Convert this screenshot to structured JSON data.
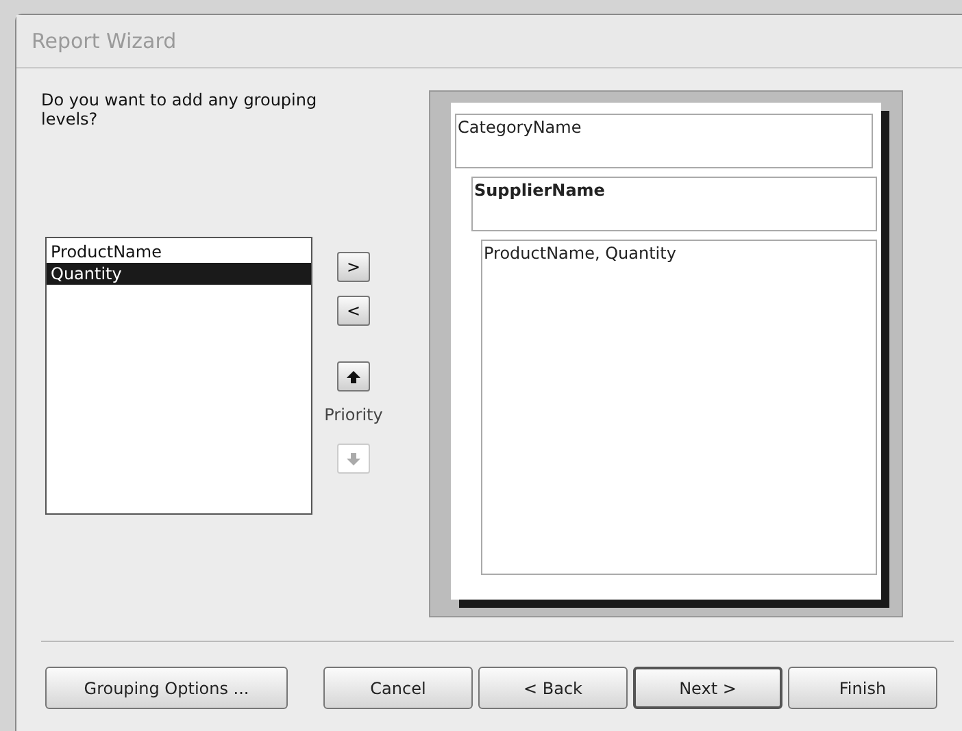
{
  "window": {
    "title": "Report Wizard"
  },
  "question": "Do you want to add any grouping levels?",
  "fields": [
    {
      "label": "ProductName",
      "selected": false
    },
    {
      "label": "Quantity",
      "selected": true
    }
  ],
  "move_buttons": [
    {
      "kind": "text",
      "label": ">",
      "disabled": false
    },
    {
      "kind": "text",
      "label": "<",
      "disabled": false
    },
    {
      "kind": "up",
      "disabled": false
    },
    {
      "kind": "caption",
      "label": "Priority"
    },
    {
      "kind": "down",
      "disabled": true
    }
  ],
  "preview": [
    {
      "label": "CategoryName",
      "bold": false,
      "kind": "header"
    },
    {
      "label": "SupplierName",
      "bold": true,
      "kind": "header"
    },
    {
      "label": "ProductName, Quantity",
      "bold": false,
      "kind": "detail"
    }
  ],
  "buttons": [
    {
      "label": "Grouping Options ...",
      "default": false
    },
    {
      "label": "Cancel",
      "default": false
    },
    {
      "label": "< Back",
      "default": false
    },
    {
      "label": "Next >",
      "default": true
    },
    {
      "label": "Finish",
      "default": false
    }
  ]
}
